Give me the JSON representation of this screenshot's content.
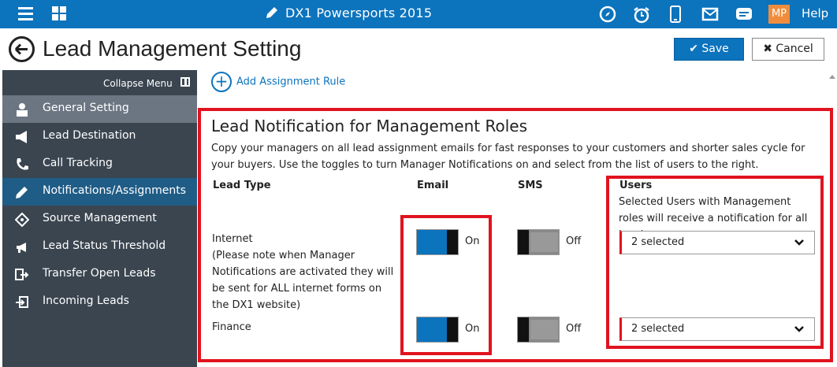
{
  "app": {
    "title": "DX1 Powersports 2015",
    "help": "Help",
    "user_initials": "MP"
  },
  "header": {
    "page_title": "Lead Management Setting",
    "save_label": "Save",
    "cancel_label": "Cancel"
  },
  "sidebar": {
    "collapse_label": "Collapse Menu",
    "items": [
      {
        "label": "General Setting",
        "icon": "user-icon"
      },
      {
        "label": "Lead Destination",
        "icon": "megaphone-icon"
      },
      {
        "label": "Call Tracking",
        "icon": "phone-icon"
      },
      {
        "label": "Notifications/Assignments",
        "icon": "pencil-icon"
      },
      {
        "label": "Source Management",
        "icon": "tag-icon"
      },
      {
        "label": "Lead Status Threshold",
        "icon": "announce-icon"
      },
      {
        "label": "Transfer Open Leads",
        "icon": "transfer-icon"
      },
      {
        "label": "Incoming Leads",
        "icon": "incoming-icon"
      }
    ]
  },
  "content": {
    "add_rule": "Add Assignment Rule",
    "section_title": "Lead Notification for Management Roles",
    "description": "Copy your managers on all lead assignment emails for fast responses to your customers and shorter sales cycle for your buyers. Use the toggles to turn Manager Notifications on and select from the list of users to the right.",
    "columns": {
      "lead_type": "Lead Type",
      "email": "Email",
      "sms": "SMS",
      "users": "Users"
    },
    "users_description": "Selected Users with Management roles will receive a notification for all Leads",
    "rows": [
      {
        "lead_type": "Internet",
        "note": "(Please note when Manager Notifications are activated they will be sent for ALL internet forms on the DX1 website)",
        "email_state": "On",
        "sms_state": "Off",
        "users_selected": "2 selected"
      },
      {
        "lead_type": "Finance",
        "note": "",
        "email_state": "On",
        "sms_state": "Off",
        "users_selected": "2 selected"
      }
    ]
  },
  "colors": {
    "brand": "#0c73bd",
    "sidebar": "#3a4550",
    "highlight": "#e0131f",
    "avatar": "#f08d3c"
  }
}
